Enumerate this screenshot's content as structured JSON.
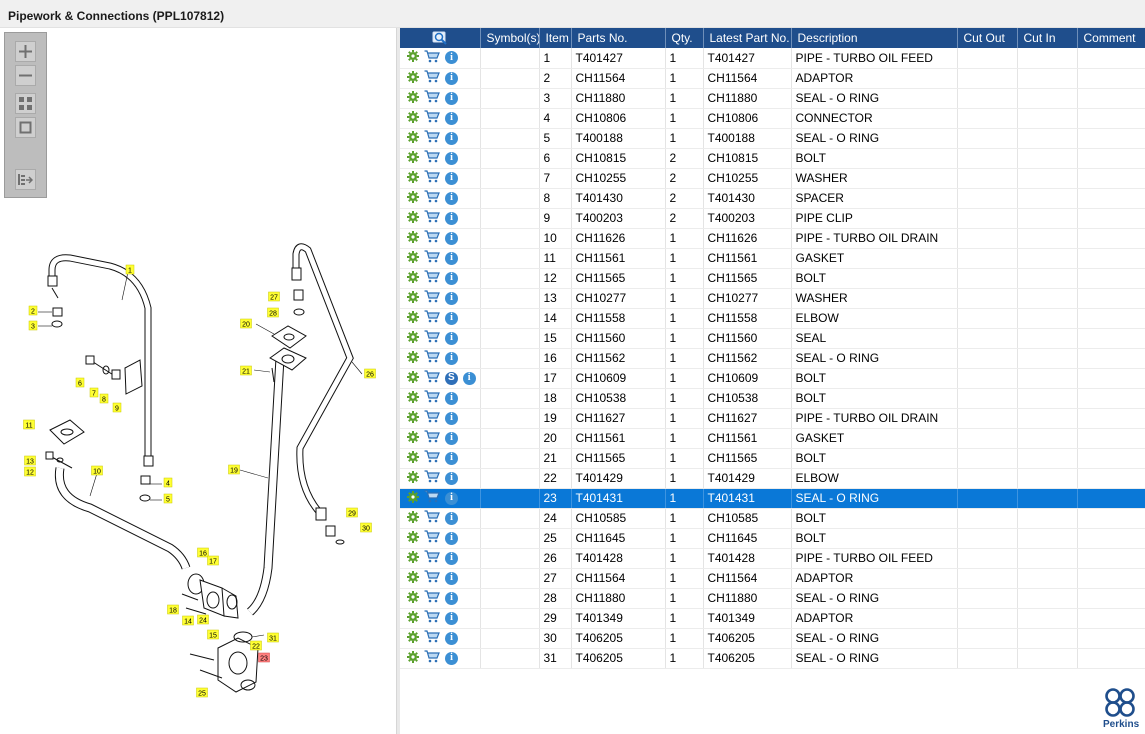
{
  "window": {
    "title": "Pipework & Connections (PPL107812)"
  },
  "toolbox": {
    "buttons": [
      "zoom-in",
      "zoom-out",
      "fit-all",
      "actual-size",
      "show-list"
    ]
  },
  "table": {
    "columns": [
      "",
      "Symbol(s)",
      "Item",
      "Parts No.",
      "Qty.",
      "Latest Part No.",
      "Description",
      "Cut Out",
      "Cut In",
      "Comment"
    ],
    "selected_item": "23",
    "rows": [
      {
        "item": "1",
        "part": "T401427",
        "qty": "1",
        "latest": "T401427",
        "desc": "PIPE - TURBO OIL FEED",
        "s": false
      },
      {
        "item": "2",
        "part": "CH11564",
        "qty": "1",
        "latest": "CH11564",
        "desc": "ADAPTOR",
        "s": false
      },
      {
        "item": "3",
        "part": "CH11880",
        "qty": "1",
        "latest": "CH11880",
        "desc": "SEAL - O RING",
        "s": false
      },
      {
        "item": "4",
        "part": "CH10806",
        "qty": "1",
        "latest": "CH10806",
        "desc": "CONNECTOR",
        "s": false
      },
      {
        "item": "5",
        "part": "T400188",
        "qty": "1",
        "latest": "T400188",
        "desc": "SEAL - O RING",
        "s": false
      },
      {
        "item": "6",
        "part": "CH10815",
        "qty": "2",
        "latest": "CH10815",
        "desc": "BOLT",
        "s": false
      },
      {
        "item": "7",
        "part": "CH10255",
        "qty": "2",
        "latest": "CH10255",
        "desc": "WASHER",
        "s": false
      },
      {
        "item": "8",
        "part": "T401430",
        "qty": "2",
        "latest": "T401430",
        "desc": "SPACER",
        "s": false
      },
      {
        "item": "9",
        "part": "T400203",
        "qty": "2",
        "latest": "T400203",
        "desc": "PIPE CLIP",
        "s": false
      },
      {
        "item": "10",
        "part": "CH11626",
        "qty": "1",
        "latest": "CH11626",
        "desc": "PIPE - TURBO OIL DRAIN",
        "s": false
      },
      {
        "item": "11",
        "part": "CH11561",
        "qty": "1",
        "latest": "CH11561",
        "desc": "GASKET",
        "s": false
      },
      {
        "item": "12",
        "part": "CH11565",
        "qty": "1",
        "latest": "CH11565",
        "desc": "BOLT",
        "s": false
      },
      {
        "item": "13",
        "part": "CH10277",
        "qty": "1",
        "latest": "CH10277",
        "desc": "WASHER",
        "s": false
      },
      {
        "item": "14",
        "part": "CH11558",
        "qty": "1",
        "latest": "CH11558",
        "desc": "ELBOW",
        "s": false
      },
      {
        "item": "15",
        "part": "CH11560",
        "qty": "1",
        "latest": "CH11560",
        "desc": "SEAL",
        "s": false
      },
      {
        "item": "16",
        "part": "CH11562",
        "qty": "1",
        "latest": "CH11562",
        "desc": "SEAL - O RING",
        "s": false
      },
      {
        "item": "17",
        "part": "CH10609",
        "qty": "1",
        "latest": "CH10609",
        "desc": "BOLT",
        "s": true
      },
      {
        "item": "18",
        "part": "CH10538",
        "qty": "1",
        "latest": "CH10538",
        "desc": "BOLT",
        "s": false
      },
      {
        "item": "19",
        "part": "CH11627",
        "qty": "1",
        "latest": "CH11627",
        "desc": "PIPE - TURBO OIL DRAIN",
        "s": false
      },
      {
        "item": "20",
        "part": "CH11561",
        "qty": "1",
        "latest": "CH11561",
        "desc": "GASKET",
        "s": false
      },
      {
        "item": "21",
        "part": "CH11565",
        "qty": "1",
        "latest": "CH11565",
        "desc": "BOLT",
        "s": false
      },
      {
        "item": "22",
        "part": "T401429",
        "qty": "1",
        "latest": "T401429",
        "desc": "ELBOW",
        "s": false
      },
      {
        "item": "23",
        "part": "T401431",
        "qty": "1",
        "latest": "T401431",
        "desc": "SEAL - O RING",
        "s": false
      },
      {
        "item": "24",
        "part": "CH10585",
        "qty": "1",
        "latest": "CH10585",
        "desc": "BOLT",
        "s": false
      },
      {
        "item": "25",
        "part": "CH11645",
        "qty": "1",
        "latest": "CH11645",
        "desc": "BOLT",
        "s": false
      },
      {
        "item": "26",
        "part": "T401428",
        "qty": "1",
        "latest": "T401428",
        "desc": "PIPE - TURBO OIL FEED",
        "s": false
      },
      {
        "item": "27",
        "part": "CH11564",
        "qty": "1",
        "latest": "CH11564",
        "desc": "ADAPTOR",
        "s": false
      },
      {
        "item": "28",
        "part": "CH11880",
        "qty": "1",
        "latest": "CH11880",
        "desc": "SEAL - O RING",
        "s": false
      },
      {
        "item": "29",
        "part": "T401349",
        "qty": "1",
        "latest": "T401349",
        "desc": "ADAPTOR",
        "s": false
      },
      {
        "item": "30",
        "part": "T406205",
        "qty": "1",
        "latest": "T406205",
        "desc": "SEAL - O RING",
        "s": false
      },
      {
        "item": "31",
        "part": "T406205",
        "qty": "1",
        "latest": "T406205",
        "desc": "SEAL - O RING",
        "s": false
      }
    ]
  },
  "diagram": {
    "callouts": [
      "1",
      "2",
      "3",
      "4",
      "5",
      "6",
      "7",
      "8",
      "9",
      "10",
      "11",
      "12",
      "13",
      "14",
      "15",
      "16",
      "17",
      "18",
      "19",
      "20",
      "21",
      "22",
      "23",
      "24",
      "25",
      "26",
      "27",
      "28",
      "29",
      "30",
      "31"
    ],
    "highlighted": "23"
  },
  "logo": {
    "text": "Perkins"
  },
  "colors": {
    "header_bg": "#1f4e8c",
    "selected_row": "#0a78d7",
    "callout_bg": "#ffff33",
    "callout_highlight": "#ff8080"
  }
}
